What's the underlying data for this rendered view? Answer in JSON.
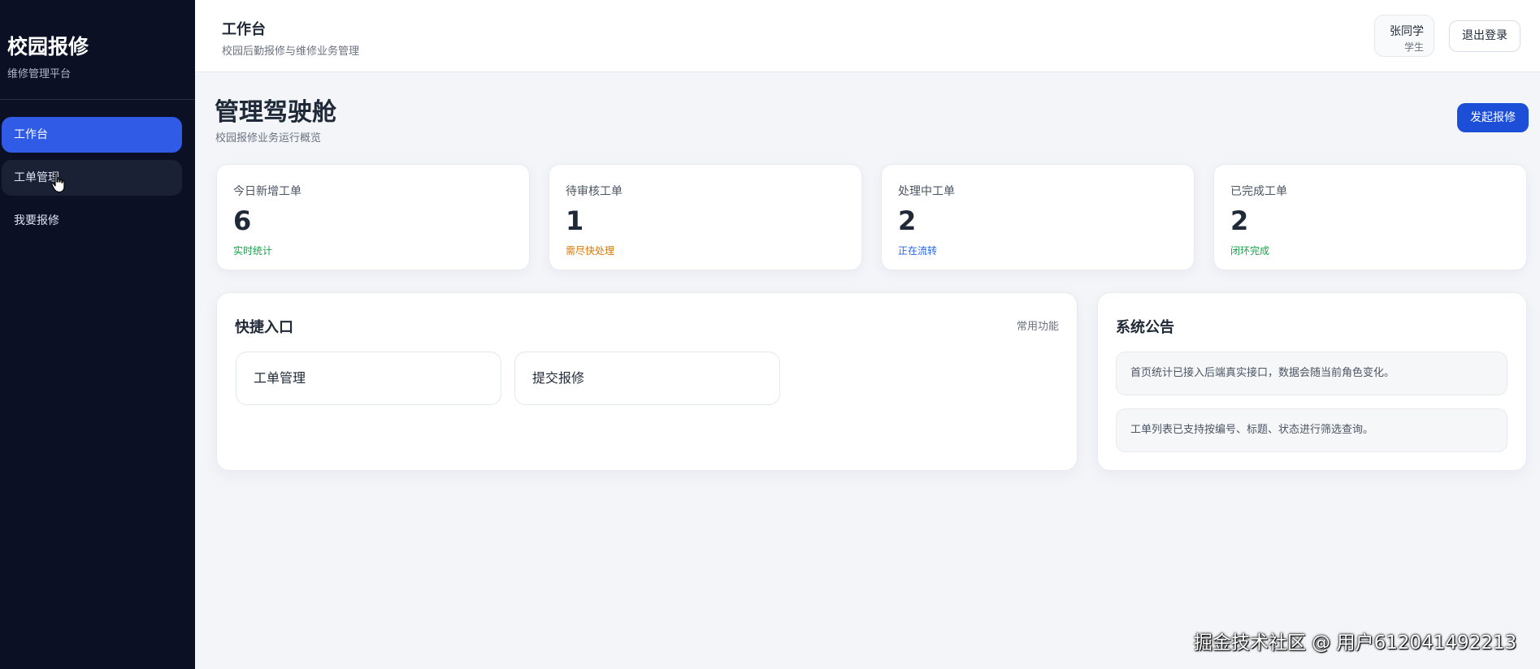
{
  "app": {
    "brand_title": "校园报修",
    "brand_subtitle": "维修管理平台"
  },
  "sidebar": {
    "items": [
      {
        "label": "工作台",
        "state": "active"
      },
      {
        "label": "工单管理",
        "state": "hover"
      },
      {
        "label": "我要报修",
        "state": "normal"
      }
    ]
  },
  "header": {
    "title": "工作台",
    "subtitle": "校园后勤报修与维修业务管理",
    "user_name": "张同学",
    "user_role": "学生",
    "logout_label": "退出登录"
  },
  "page": {
    "title": "管理驾驶舱",
    "subtitle": "校园报修业务运行概览",
    "primary_action": "发起报修"
  },
  "stats": [
    {
      "label": "今日新增工单",
      "value": "6",
      "note": "实时统计",
      "note_color": "#16a34a"
    },
    {
      "label": "待审核工单",
      "value": "1",
      "note": "需尽快处理",
      "note_color": "#d97706"
    },
    {
      "label": "处理中工单",
      "value": "2",
      "note": "正在流转",
      "note_color": "#2563eb"
    },
    {
      "label": "已完成工单",
      "value": "2",
      "note": "闭环完成",
      "note_color": "#16a34a"
    }
  ],
  "quick_entry": {
    "title": "快捷入口",
    "meta": "常用功能",
    "items": [
      {
        "label": "工单管理"
      },
      {
        "label": "提交报修"
      }
    ]
  },
  "announcements": {
    "title": "系统公告",
    "items": [
      {
        "text": "首页统计已接入后端真实接口，数据会随当前角色变化。"
      },
      {
        "text": "工单列表已支持按编号、标题、状态进行筛选查询。"
      }
    ]
  },
  "watermark": "掘金技术社区 @ 用户612041492213",
  "colors": {
    "sidebar_bg": "#0b1024",
    "accent": "#2f5be7",
    "primary_button": "#1d4ed8",
    "page_bg": "#f3f5f9"
  }
}
